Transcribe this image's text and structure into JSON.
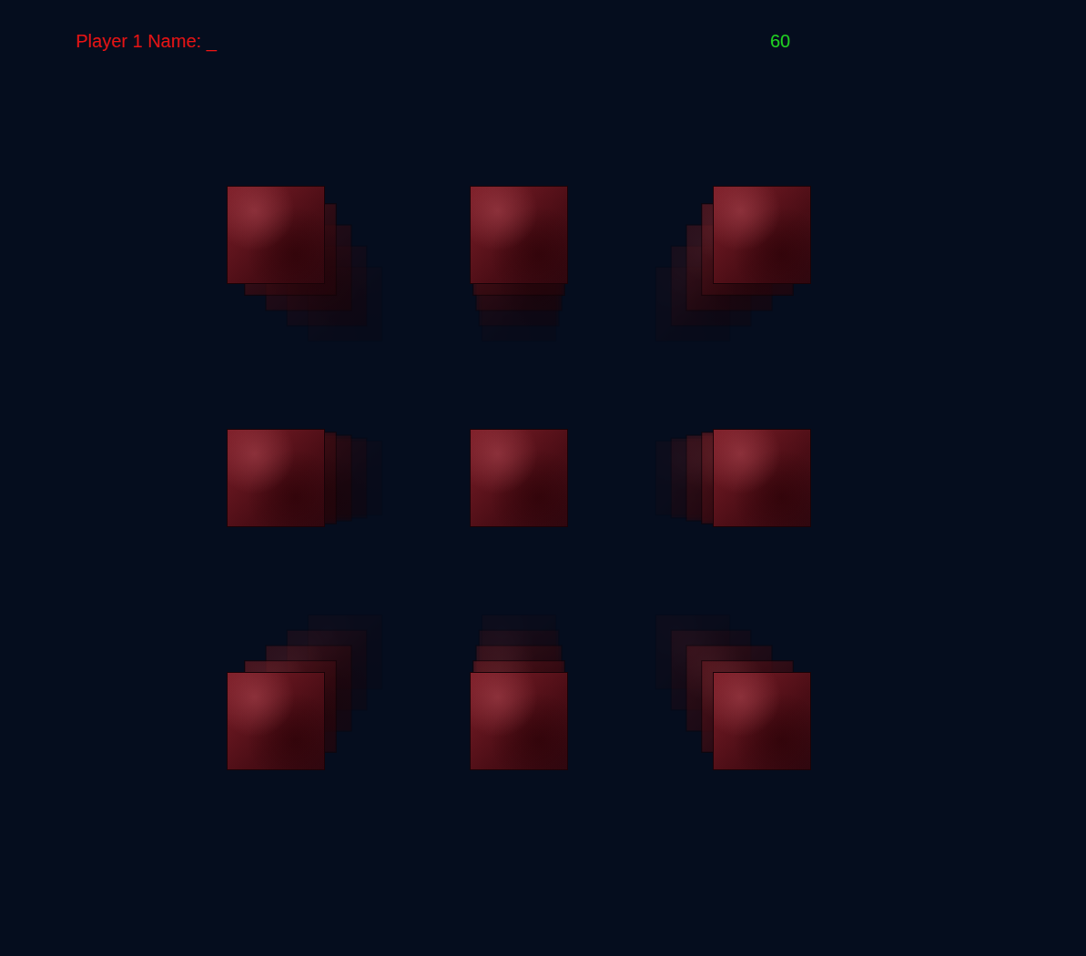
{
  "hud": {
    "prompt": "Player 1 Name: _",
    "counter": "60"
  },
  "cubes": [
    {
      "kind": "nw"
    },
    {
      "kind": "n"
    },
    {
      "kind": "ne"
    },
    {
      "kind": "w"
    },
    {
      "kind": "center"
    },
    {
      "kind": "e"
    },
    {
      "kind": "sw"
    },
    {
      "kind": "s"
    },
    {
      "kind": "se"
    }
  ]
}
